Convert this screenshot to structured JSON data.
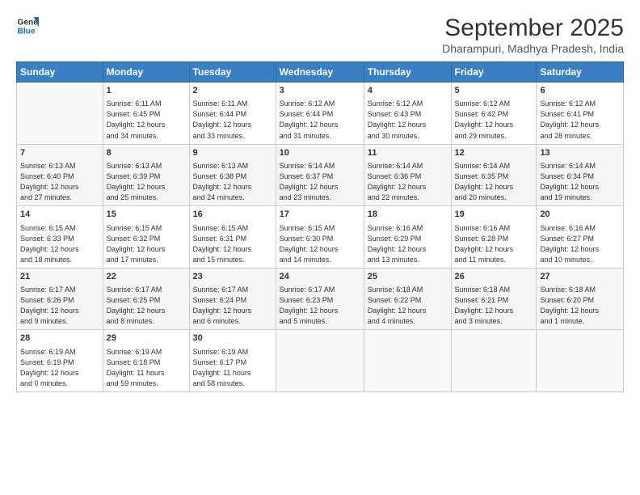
{
  "logo": {
    "line1": "General",
    "line2": "Blue"
  },
  "title": "September 2025",
  "subtitle": "Dharampuri, Madhya Pradesh, India",
  "days_of_week": [
    "Sunday",
    "Monday",
    "Tuesday",
    "Wednesday",
    "Thursday",
    "Friday",
    "Saturday"
  ],
  "weeks": [
    [
      {
        "day": "",
        "info": ""
      },
      {
        "day": "1",
        "info": "Sunrise: 6:11 AM\nSunset: 6:45 PM\nDaylight: 12 hours\nand 34 minutes."
      },
      {
        "day": "2",
        "info": "Sunrise: 6:11 AM\nSunset: 6:44 PM\nDaylight: 12 hours\nand 33 minutes."
      },
      {
        "day": "3",
        "info": "Sunrise: 6:12 AM\nSunset: 6:44 PM\nDaylight: 12 hours\nand 31 minutes."
      },
      {
        "day": "4",
        "info": "Sunrise: 6:12 AM\nSunset: 6:43 PM\nDaylight: 12 hours\nand 30 minutes."
      },
      {
        "day": "5",
        "info": "Sunrise: 6:12 AM\nSunset: 6:42 PM\nDaylight: 12 hours\nand 29 minutes."
      },
      {
        "day": "6",
        "info": "Sunrise: 6:12 AM\nSunset: 6:41 PM\nDaylight: 12 hours\nand 28 minutes."
      }
    ],
    [
      {
        "day": "7",
        "info": "Sunrise: 6:13 AM\nSunset: 6:40 PM\nDaylight: 12 hours\nand 27 minutes."
      },
      {
        "day": "8",
        "info": "Sunrise: 6:13 AM\nSunset: 6:39 PM\nDaylight: 12 hours\nand 25 minutes."
      },
      {
        "day": "9",
        "info": "Sunrise: 6:13 AM\nSunset: 6:38 PM\nDaylight: 12 hours\nand 24 minutes."
      },
      {
        "day": "10",
        "info": "Sunrise: 6:14 AM\nSunset: 6:37 PM\nDaylight: 12 hours\nand 23 minutes."
      },
      {
        "day": "11",
        "info": "Sunrise: 6:14 AM\nSunset: 6:36 PM\nDaylight: 12 hours\nand 22 minutes."
      },
      {
        "day": "12",
        "info": "Sunrise: 6:14 AM\nSunset: 6:35 PM\nDaylight: 12 hours\nand 20 minutes."
      },
      {
        "day": "13",
        "info": "Sunrise: 6:14 AM\nSunset: 6:34 PM\nDaylight: 12 hours\nand 19 minutes."
      }
    ],
    [
      {
        "day": "14",
        "info": "Sunrise: 6:15 AM\nSunset: 6:33 PM\nDaylight: 12 hours\nand 18 minutes."
      },
      {
        "day": "15",
        "info": "Sunrise: 6:15 AM\nSunset: 6:32 PM\nDaylight: 12 hours\nand 17 minutes."
      },
      {
        "day": "16",
        "info": "Sunrise: 6:15 AM\nSunset: 6:31 PM\nDaylight: 12 hours\nand 15 minutes."
      },
      {
        "day": "17",
        "info": "Sunrise: 6:15 AM\nSunset: 6:30 PM\nDaylight: 12 hours\nand 14 minutes."
      },
      {
        "day": "18",
        "info": "Sunrise: 6:16 AM\nSunset: 6:29 PM\nDaylight: 12 hours\nand 13 minutes."
      },
      {
        "day": "19",
        "info": "Sunrise: 6:16 AM\nSunset: 6:28 PM\nDaylight: 12 hours\nand 11 minutes."
      },
      {
        "day": "20",
        "info": "Sunrise: 6:16 AM\nSunset: 6:27 PM\nDaylight: 12 hours\nand 10 minutes."
      }
    ],
    [
      {
        "day": "21",
        "info": "Sunrise: 6:17 AM\nSunset: 6:26 PM\nDaylight: 12 hours\nand 9 minutes."
      },
      {
        "day": "22",
        "info": "Sunrise: 6:17 AM\nSunset: 6:25 PM\nDaylight: 12 hours\nand 8 minutes."
      },
      {
        "day": "23",
        "info": "Sunrise: 6:17 AM\nSunset: 6:24 PM\nDaylight: 12 hours\nand 6 minutes."
      },
      {
        "day": "24",
        "info": "Sunrise: 6:17 AM\nSunset: 6:23 PM\nDaylight: 12 hours\nand 5 minutes."
      },
      {
        "day": "25",
        "info": "Sunrise: 6:18 AM\nSunset: 6:22 PM\nDaylight: 12 hours\nand 4 minutes."
      },
      {
        "day": "26",
        "info": "Sunrise: 6:18 AM\nSunset: 6:21 PM\nDaylight: 12 hours\nand 3 minutes."
      },
      {
        "day": "27",
        "info": "Sunrise: 6:18 AM\nSunset: 6:20 PM\nDaylight: 12 hours\nand 1 minute."
      }
    ],
    [
      {
        "day": "28",
        "info": "Sunrise: 6:19 AM\nSunset: 6:19 PM\nDaylight: 12 hours\nand 0 minutes."
      },
      {
        "day": "29",
        "info": "Sunrise: 6:19 AM\nSunset: 6:18 PM\nDaylight: 11 hours\nand 59 minutes."
      },
      {
        "day": "30",
        "info": "Sunrise: 6:19 AM\nSunset: 6:17 PM\nDaylight: 11 hours\nand 58 minutes."
      },
      {
        "day": "",
        "info": ""
      },
      {
        "day": "",
        "info": ""
      },
      {
        "day": "",
        "info": ""
      },
      {
        "day": "",
        "info": ""
      }
    ]
  ]
}
